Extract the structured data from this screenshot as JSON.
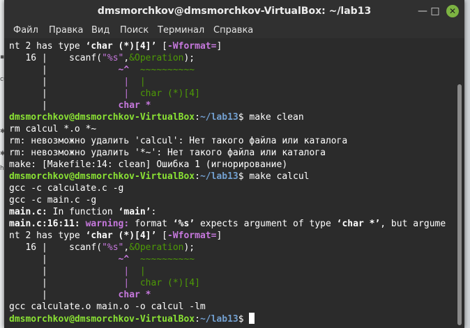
{
  "window": {
    "title": "dmsmorchkov@dmsmorchkov-VirtualBox: ~/lab13"
  },
  "menu": [
    "Файл",
    "Правка",
    "Вид",
    "Поиск",
    "Терминал",
    "Справка"
  ],
  "background": {
    "fragments": [
      "cul",
      "h.c"
    ]
  },
  "prompt": {
    "user": "dmsmorchkov@dmsmorchkov-VirtualBox",
    "path": "~/lab13",
    "sign": "$"
  },
  "terminal": {
    "l1_a": "nt 2 has type ",
    "l1_b": "‘char (*)[4]’",
    "l1_c": " [",
    "l1_d": "-Wformat=",
    "l1_e": "]",
    "l2_a": "   16 |    scanf(",
    "l2_b": "\"%s\"",
    "l2_c": ",",
    "l2_d": "&Operation",
    "l2_e": ");",
    "l3_a": "      |             ",
    "l3_b": "~^",
    "l3_c": "  ~~~~~~~~~~",
    "l4_a": "      |              ",
    "l4_b": "|",
    "l4_c": "  |",
    "l5_a": "      |              ",
    "l5_b": "|",
    "l5_c": "  char (*)[4]",
    "l6_a": "      |             ",
    "l6_b": "char *",
    "cmd1": " make clean",
    "out1": "rm calcul *.o *~",
    "out2": "rm: невозможно удалить 'calcul': Нет такого файла или каталога",
    "out3": "rm: невозможно удалить '*~': Нет такого файла или каталога",
    "out4": "make: [Makefile:14: clean] Ошибка 1 (игнорирование)",
    "cmd2": " make calcul",
    "out5": "gcc -c calculate.c -g",
    "out6": "gcc -c main.c -g",
    "fn_a": "main.c:",
    "fn_b": " In function ",
    "fn_c": "‘main’",
    "fn_d": ":",
    "w_a": "main.c:16:11:",
    "w_b": " warning:",
    "w_c": " format ",
    "w_d": "‘%s’",
    "w_e": " expects argument of type ",
    "w_f": "‘char *’",
    "w_g": ", but argume",
    "out7": "gcc calculate.o main.o -o calcul -lm"
  }
}
